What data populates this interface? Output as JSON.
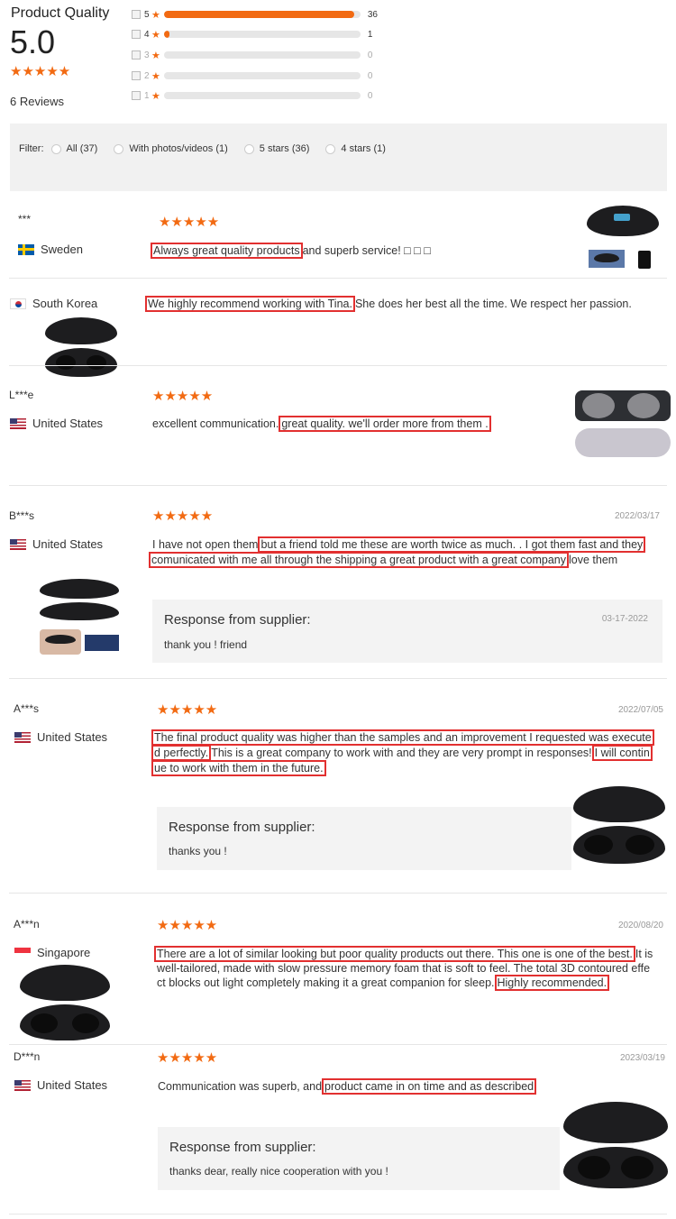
{
  "summary": {
    "title": "Product Quality",
    "score": "5.0",
    "stars": "★★★★★",
    "review_count": "6 Reviews",
    "breakdown": [
      {
        "star": "5",
        "count": "36",
        "fraction": 0.97
      },
      {
        "star": "4",
        "count": "1",
        "fraction": 0.03
      },
      {
        "star": "3",
        "count": "0",
        "fraction": 0
      },
      {
        "star": "2",
        "count": "0",
        "fraction": 0
      },
      {
        "star": "1",
        "count": "0",
        "fraction": 0
      }
    ]
  },
  "filter": {
    "label": "Filter:",
    "options": [
      "All (37)",
      "With photos/videos (1)",
      "5 stars (36)",
      "4 stars (1)"
    ]
  },
  "reviews": [
    {
      "name": "***",
      "country": "Sweden",
      "stars": "★★★★★",
      "date": "",
      "text_hl1": "Always great quality products",
      "text_rest": "and superb service! □ □ □"
    },
    {
      "name": "",
      "country": "South Korea",
      "stars": "",
      "date": "",
      "text_hl1": "We highly recommend working with Tina.",
      "text_rest": "She does her best all the time. We respect her passion."
    },
    {
      "name": "L***e",
      "country": "United States",
      "stars": "★★★★★",
      "date": "",
      "text_plain": "excellent communication.",
      "text_hl1": "great quality. we'll order more from them ."
    },
    {
      "name": "B***s",
      "country": "United States",
      "stars": "★★★★★",
      "date": "2022/03/17",
      "text_plain": "I have not open them",
      "text_hl1": "but a friend told me these are worth twice as much. . I got them fast and they",
      "text_hl2": "comunicated with me all through the shipping a great product with a great company",
      "text_rest": "love them",
      "response_title": "Response from supplier:",
      "response_text": "thank you ! friend",
      "response_date": "03-17-2022"
    },
    {
      "name": "A***s",
      "country": "United States",
      "stars": "★★★★★",
      "date": "2022/07/05",
      "text_hl1": "The final product quality was higher than the samples and an improvement I requested was execute",
      "text_hl1b": "d perfectly.",
      "text_mid": "This is a great company to work with and they are very prompt in responses!",
      "text_hl2": "I will contin",
      "text_hl2b": "ue to work with them in the future.",
      "response_title": "Response from supplier:",
      "response_text": "thanks you !"
    },
    {
      "name": "A***n",
      "country": "Singapore",
      "stars": "★★★★★",
      "date": "2020/08/20",
      "text_hl1": "There are a lot of similar looking but poor quality products out there. This one is one of the best.",
      "text_mid1": "It is",
      "text_mid2": "well-tailored, made with slow pressure memory foam that is soft to feel. The total 3D contoured effe",
      "text_mid3": "ct blocks out light completely making it a great companion for sleep.",
      "text_hl2": "Highly recommended."
    },
    {
      "name": "D***n",
      "country": "United States",
      "stars": "★★★★★",
      "date": "2023/03/19",
      "text_plain": "Communication was superb, and",
      "text_hl1": "product came in on time and as described",
      "response_title": "Response from supplier:",
      "response_text": "thanks dear, really nice cooperation with you !"
    }
  ],
  "colors": {
    "accent": "#f26a12",
    "highlight_box": "#e23030",
    "panel_bg": "#f1f1f1"
  }
}
